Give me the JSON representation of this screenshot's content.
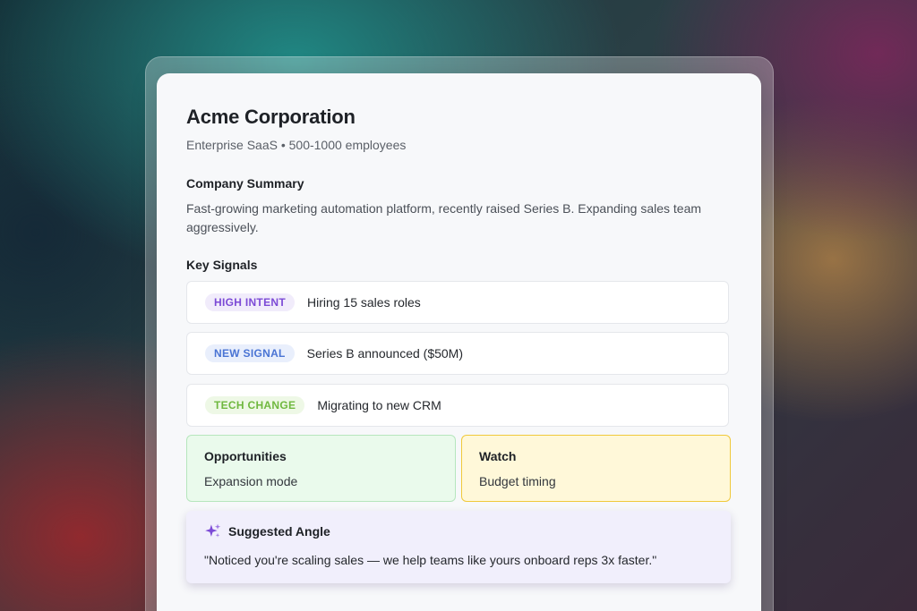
{
  "company": {
    "name": "Acme Corporation",
    "subtitle": "Enterprise SaaS • 500-1000 employees"
  },
  "summary": {
    "heading": "Company Summary",
    "text": "Fast-growing marketing automation platform, recently raised Series B. Expanding sales team aggressively."
  },
  "signals": {
    "heading": "Key Signals",
    "items": [
      {
        "badge": "HIGH INTENT",
        "text": "Hiring 15 sales roles",
        "color": "#7c4ad6"
      },
      {
        "badge": "NEW SIGNAL",
        "text": "Series B announced ($50M)",
        "color": "#4a74d4"
      },
      {
        "badge": "TECH CHANGE",
        "text": "Migrating to new CRM",
        "color": "#6fb83f"
      }
    ]
  },
  "tiles": {
    "opportunities": {
      "title": "Opportunities",
      "value": "Expansion mode",
      "color": "#eafaec"
    },
    "watch": {
      "title": "Watch",
      "value": "Budget timing",
      "color": "#fff8d9"
    }
  },
  "angle": {
    "icon": "sparkle-icon",
    "title": "Suggested Angle",
    "quote": "\"Noticed you're scaling sales — we help teams like yours onboard reps 3x faster.\""
  }
}
